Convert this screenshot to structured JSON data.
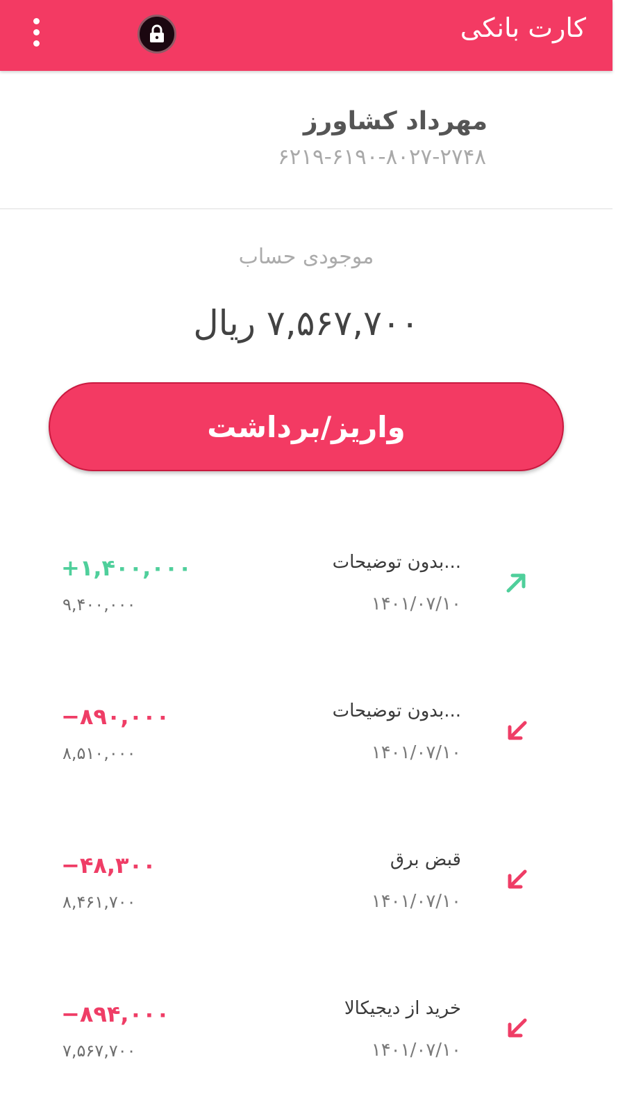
{
  "header": {
    "title": "کارت بانکی",
    "menu_icon": "more-vertical-icon",
    "lock_icon": "lock-icon"
  },
  "card": {
    "holder_name": "مهرداد کشاورز",
    "number": "۶۲۱۹-۶۱۹۰-۸۰۲۷-۲۷۴۸"
  },
  "balance": {
    "label": "موجودی حساب",
    "amount": "۷,۵۶۷,۷۰۰ ریال"
  },
  "actions": {
    "deposit_withdraw_label": "واریز/برداشت"
  },
  "colors": {
    "primary": "#F33A63",
    "income": "#4fcf9b",
    "expense": "#ef3d66"
  },
  "transactions": [
    {
      "amount": "+۱,۴۰۰,۰۰۰",
      "balance_after": "۹,۴۰۰,۰۰۰",
      "description": "...بدون توضیحات",
      "date": "۱۴۰۱/۰۷/۱۰",
      "direction": "income",
      "icon": "arrow-up-right-icon"
    },
    {
      "amount": "−۸۹۰,۰۰۰",
      "balance_after": "۸,۵۱۰,۰۰۰",
      "description": "...بدون توضیحات",
      "date": "۱۴۰۱/۰۷/۱۰",
      "direction": "expense",
      "icon": "arrow-down-left-icon"
    },
    {
      "amount": "−۴۸,۳۰۰",
      "balance_after": "۸,۴۶۱,۷۰۰",
      "description": "قبض برق",
      "date": "۱۴۰۱/۰۷/۱۰",
      "direction": "expense",
      "icon": "arrow-down-left-icon"
    },
    {
      "amount": "−۸۹۴,۰۰۰",
      "balance_after": "۷,۵۶۷,۷۰۰",
      "description": "خرید از دیجیکالا",
      "date": "۱۴۰۱/۰۷/۱۰",
      "direction": "expense",
      "icon": "arrow-down-left-icon"
    }
  ]
}
